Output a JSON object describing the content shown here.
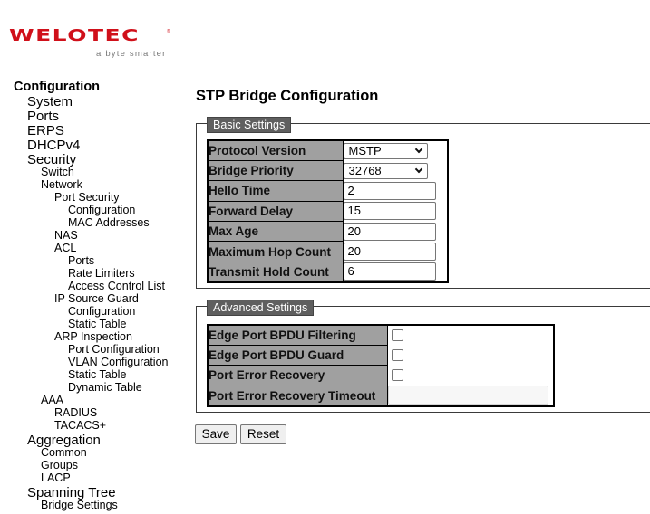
{
  "brand": {
    "name": "WELOTEC",
    "tagline": "a byte smarter",
    "color": "#d0101a"
  },
  "nav": {
    "items": [
      {
        "label": "Configuration",
        "level": 0
      },
      {
        "label": "System",
        "level": 1
      },
      {
        "label": "Ports",
        "level": 1
      },
      {
        "label": "ERPS",
        "level": 1
      },
      {
        "label": "DHCPv4",
        "level": 1
      },
      {
        "label": "Security",
        "level": 1
      },
      {
        "label": "Switch",
        "level": 2
      },
      {
        "label": "Network",
        "level": 2
      },
      {
        "label": "Port Security",
        "level": 3
      },
      {
        "label": "Configuration",
        "level": 4
      },
      {
        "label": "MAC Addresses",
        "level": 4
      },
      {
        "label": "NAS",
        "level": 3
      },
      {
        "label": "ACL",
        "level": 3
      },
      {
        "label": "Ports",
        "level": 4
      },
      {
        "label": "Rate Limiters",
        "level": 4
      },
      {
        "label": "Access Control List",
        "level": 4
      },
      {
        "label": "IP Source Guard",
        "level": 3
      },
      {
        "label": "Configuration",
        "level": 4
      },
      {
        "label": "Static Table",
        "level": 4
      },
      {
        "label": "ARP Inspection",
        "level": 3
      },
      {
        "label": "Port Configuration",
        "level": 4
      },
      {
        "label": "VLAN Configuration",
        "level": 4
      },
      {
        "label": "Static Table",
        "level": 4
      },
      {
        "label": "Dynamic Table",
        "level": 4
      },
      {
        "label": "AAA",
        "level": 2
      },
      {
        "label": "RADIUS",
        "level": 3
      },
      {
        "label": "TACACS+",
        "level": 3
      },
      {
        "label": "Aggregation",
        "level": 1
      },
      {
        "label": "Common",
        "level": 2
      },
      {
        "label": "Groups",
        "level": 2
      },
      {
        "label": "LACP",
        "level": 2
      },
      {
        "label": "Spanning Tree",
        "level": 1
      },
      {
        "label": "Bridge Settings",
        "level": 2
      }
    ]
  },
  "page": {
    "title": "STP Bridge Configuration"
  },
  "basic": {
    "legend": "Basic Settings",
    "protocol_version": {
      "label": "Protocol Version",
      "value": "MSTP"
    },
    "bridge_priority": {
      "label": "Bridge Priority",
      "value": "32768"
    },
    "hello_time": {
      "label": "Hello Time",
      "value": "2"
    },
    "forward_delay": {
      "label": "Forward Delay",
      "value": "15"
    },
    "max_age": {
      "label": "Max Age",
      "value": "20"
    },
    "max_hop_count": {
      "label": "Maximum Hop Count",
      "value": "20"
    },
    "tx_hold_count": {
      "label": "Transmit Hold Count",
      "value": "6"
    }
  },
  "advanced": {
    "legend": "Advanced Settings",
    "bpdu_filtering": {
      "label": "Edge Port BPDU Filtering",
      "checked": false
    },
    "bpdu_guard": {
      "label": "Edge Port BPDU Guard",
      "checked": false
    },
    "error_recovery": {
      "label": "Port Error Recovery",
      "checked": false
    },
    "error_recovery_timeout": {
      "label": "Port Error Recovery Timeout",
      "value": "",
      "disabled": true
    }
  },
  "buttons": {
    "save": "Save",
    "reset": "Reset"
  }
}
